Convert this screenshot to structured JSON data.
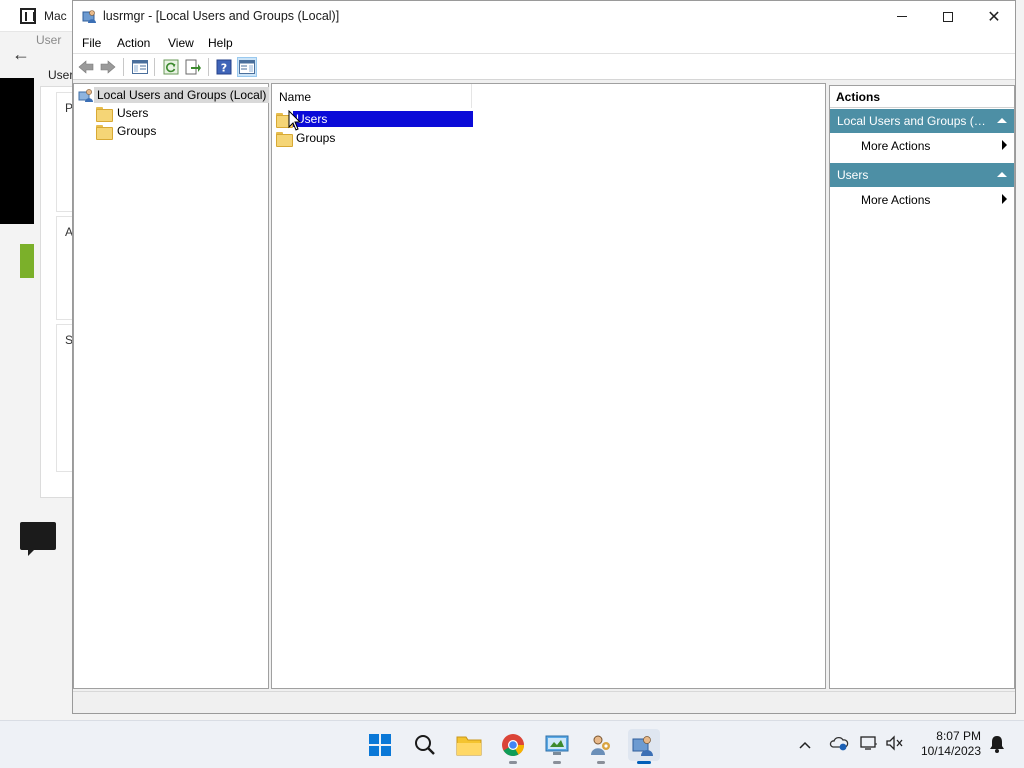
{
  "background_window": {
    "title": "Mac",
    "address": "User",
    "tab": "User",
    "card_letters": [
      "P",
      "A",
      "S"
    ]
  },
  "window": {
    "title": "lusrmgr - [Local Users and Groups (Local)]"
  },
  "menu": {
    "file": "File",
    "action": "Action",
    "view": "View",
    "help": "Help"
  },
  "tree": {
    "root": "Local Users and Groups (Local)",
    "children": [
      {
        "label": "Users"
      },
      {
        "label": "Groups"
      }
    ]
  },
  "list": {
    "column_name": "Name",
    "rows": [
      {
        "label": "Users",
        "selected": true
      },
      {
        "label": "Groups",
        "selected": false
      }
    ]
  },
  "actions": {
    "header": "Actions",
    "groups": [
      {
        "title": "Local Users and Groups (Local)",
        "item": "More Actions"
      },
      {
        "title": "Users",
        "item": "More Actions"
      }
    ]
  },
  "taskbar": {
    "time": "8:07 PM",
    "date": "10/14/2023"
  },
  "colors": {
    "selection": "#0b0bd8",
    "action_group": "#4d8fa5",
    "tree_root_highlight": "#d9d9d9"
  }
}
